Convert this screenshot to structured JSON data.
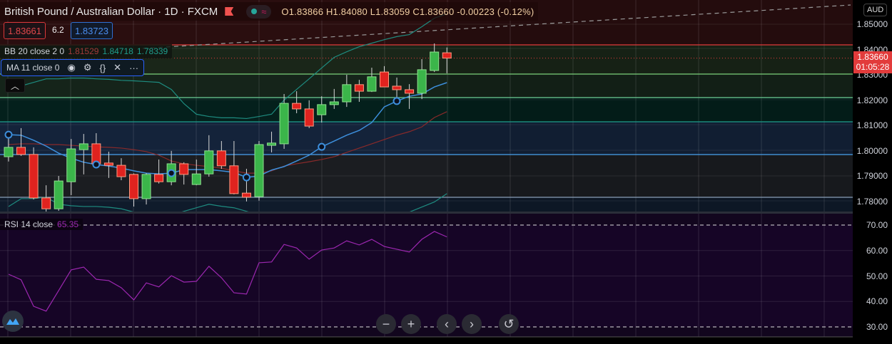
{
  "header": {
    "symbol_title": "British Pound / Australian Dollar · 1D · FXCM",
    "ohlc": {
      "open": "O1.83866",
      "high": "H1.84080",
      "low": "L1.83059",
      "close": "C1.83660",
      "change": "-0.00223 (-0.12%)"
    },
    "sell_price": "1.83661",
    "spread": "6.2",
    "buy_price": "1.83723"
  },
  "indicators": {
    "bb": {
      "label": "BB 20 close 2 0",
      "basis": "1.81529",
      "upper": "1.84718",
      "lower": "1.78339"
    },
    "ma": {
      "label": "MA 11 close 0"
    },
    "rsi": {
      "label": "RSI 14 close",
      "value": "65.35"
    }
  },
  "price_axis": {
    "currency": "AUD",
    "ticks": [
      "1.85000",
      "1.84000",
      "1.83000",
      "1.82000",
      "1.81000",
      "1.80000",
      "1.79000",
      "1.78000"
    ],
    "current_price": "1.83660",
    "countdown": "01:05:28"
  },
  "rsi_axis": {
    "ticks": [
      "70.00",
      "60.00",
      "50.00",
      "40.00",
      "30.00"
    ]
  },
  "colors": {
    "up": "#3bb54a",
    "down": "#e0231f",
    "ma": "#3d8fdc",
    "bb_basis": "#8a2a2a",
    "bb_band": "#1e8c80",
    "rsi": "#9c27b0"
  },
  "chart_data": {
    "type": "candlestick",
    "title": "British Pound / Australian Dollar · 1D · FXCM",
    "ylim": [
      1.7755,
      1.858
    ],
    "candles": [
      [
        1.7976,
        1.8054,
        1.7957,
        1.8013
      ],
      [
        1.8013,
        1.8089,
        1.7979,
        1.7985
      ],
      [
        1.7985,
        1.8013,
        1.7807,
        1.7813
      ],
      [
        1.7813,
        1.7863,
        1.7759,
        1.777
      ],
      [
        1.777,
        1.79,
        1.7762,
        1.788
      ],
      [
        1.7877,
        1.8046,
        1.7824,
        1.8007
      ],
      [
        1.8004,
        1.8066,
        1.7906,
        1.8027
      ],
      [
        1.8027,
        1.8069,
        1.794,
        1.7948
      ],
      [
        1.7951,
        1.7996,
        1.7892,
        1.7942
      ],
      [
        1.7942,
        1.797,
        1.7883,
        1.7897
      ],
      [
        1.7906,
        1.791,
        1.7779,
        1.781
      ],
      [
        1.781,
        1.7911,
        1.7787,
        1.7906
      ],
      [
        1.7906,
        1.7965,
        1.787,
        1.7877
      ],
      [
        1.7877,
        1.7999,
        1.7863,
        1.7948
      ],
      [
        1.7948,
        1.7954,
        1.7866,
        1.7906
      ],
      [
        1.7866,
        1.7965,
        1.7863,
        1.7908
      ],
      [
        1.7908,
        1.8061,
        1.7897,
        1.7999
      ],
      [
        1.7999,
        1.8038,
        1.7928,
        1.794
      ],
      [
        1.794,
        1.8038,
        1.7827,
        1.783
      ],
      [
        1.7832,
        1.7928,
        1.7799,
        1.7816
      ],
      [
        1.7818,
        1.8038,
        1.7802,
        1.8024
      ],
      [
        1.8021,
        1.8075,
        1.7993,
        1.803
      ],
      [
        1.8027,
        1.8224,
        1.8007,
        1.8187
      ],
      [
        1.8187,
        1.8235,
        1.8148,
        1.8165
      ],
      [
        1.8165,
        1.8199,
        1.8089,
        1.8097
      ],
      [
        1.8142,
        1.8215,
        1.8111,
        1.8182
      ],
      [
        1.8182,
        1.8244,
        1.8165,
        1.8193
      ],
      [
        1.8193,
        1.83,
        1.8173,
        1.8261
      ],
      [
        1.8261,
        1.828,
        1.8193,
        1.8235
      ],
      [
        1.8235,
        1.8328,
        1.8232,
        1.8292
      ],
      [
        1.8311,
        1.8334,
        1.8252,
        1.8252
      ],
      [
        1.8255,
        1.8289,
        1.821,
        1.8241
      ],
      [
        1.8241,
        1.8263,
        1.8165,
        1.8227
      ],
      [
        1.8227,
        1.8362,
        1.8204,
        1.832
      ],
      [
        1.8317,
        1.8424,
        1.8311,
        1.839
      ],
      [
        1.8387,
        1.8408,
        1.8306,
        1.8366
      ]
    ],
    "ma11": [
      1.8063,
      1.8061,
      1.8041,
      1.8018,
      1.799,
      1.797,
      1.7954,
      1.7945,
      1.7939,
      1.7931,
      1.792,
      1.7911,
      1.7908,
      1.7911,
      1.7925,
      1.7925,
      1.7925,
      1.792,
      1.7914,
      1.7894,
      1.79,
      1.7923,
      1.7937,
      1.7959,
      1.7982,
      1.8015,
      1.8038,
      1.8061,
      1.808,
      1.8111,
      1.8173,
      1.8196,
      1.8215,
      1.8224,
      1.8252,
      1.8269
    ],
    "bb_basis": [
      1.8024,
      1.8027,
      1.8027,
      1.8024,
      1.8024,
      1.8021,
      1.8018,
      1.8015,
      1.8013,
      1.801,
      1.8004,
      1.7996,
      1.7982,
      1.7959,
      1.7948,
      1.7942,
      1.7937,
      1.7931,
      1.792,
      1.7911,
      1.7911,
      1.792,
      1.7939,
      1.7948,
      1.7956,
      1.7965,
      1.7976,
      1.7993,
      1.801,
      1.8027,
      1.8044,
      1.8061,
      1.8075,
      1.8094,
      1.8131,
      1.8154
    ],
    "bb_upper": [
      1.8256,
      1.8256,
      1.827,
      1.8284,
      1.8284,
      1.8287,
      1.8287,
      1.8284,
      1.8282,
      1.8278,
      1.8276,
      1.8273,
      1.827,
      1.8242,
      1.8186,
      1.8144,
      1.8135,
      1.813,
      1.813,
      1.8127,
      1.8135,
      1.8144,
      1.82,
      1.8242,
      1.8284,
      1.8327,
      1.8369,
      1.8391,
      1.8411,
      1.8425,
      1.8439,
      1.8451,
      1.8459,
      1.849,
      1.8524,
      1.8541
    ],
    "bb_lower": [
      1.7779,
      1.781,
      1.781,
      1.7816,
      1.7788,
      1.7782,
      1.7779,
      1.7779,
      1.7776,
      1.777,
      1.7757,
      1.7745,
      1.774,
      1.7745,
      1.776,
      1.7774,
      1.7788,
      1.778,
      1.7774,
      1.776,
      1.7745,
      1.774,
      1.7735,
      1.773,
      1.7728,
      1.7726,
      1.7725,
      1.7724,
      1.7723,
      1.7724,
      1.7728,
      1.774,
      1.7757,
      1.7777,
      1.7797,
      1.783
    ],
    "rsi": {
      "ylim": [
        25,
        75
      ],
      "levels": [
        70,
        30
      ],
      "values": [
        50.7,
        48.5,
        38.1,
        36.2,
        44.3,
        52.4,
        53.5,
        48.7,
        48.2,
        45.4,
        40.6,
        47.3,
        45.7,
        50.1,
        47.6,
        47.9,
        53.8,
        49.3,
        43.4,
        42.9,
        55.2,
        55.5,
        62.4,
        61.0,
        56.6,
        60.2,
        61.0,
        63.8,
        62.2,
        64.4,
        61.6,
        60.5,
        59.4,
        64.4,
        67.5,
        65.35
      ]
    }
  }
}
